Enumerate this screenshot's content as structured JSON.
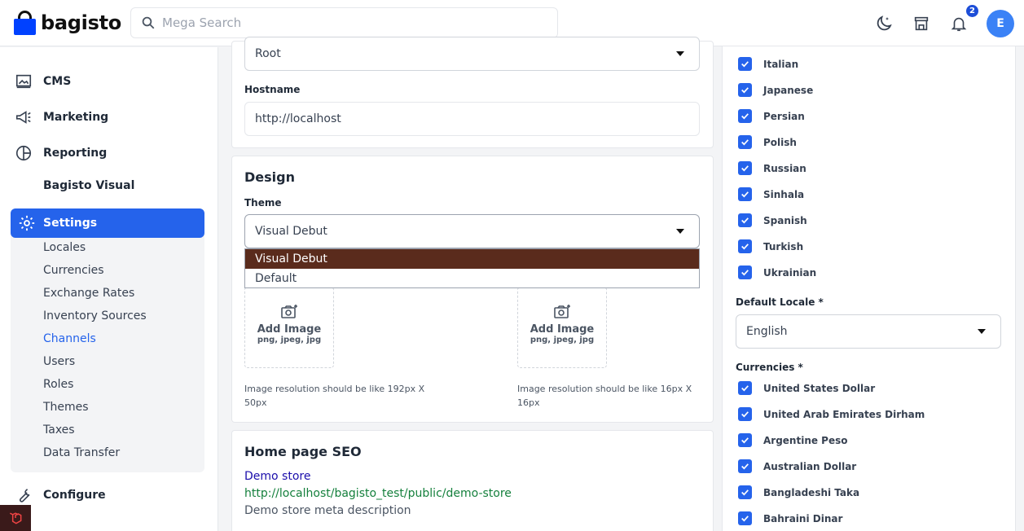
{
  "header": {
    "logo_text": "bagisto",
    "search_placeholder": "Mega Search",
    "notification_count": "2",
    "avatar_initial": "E"
  },
  "sidebar": {
    "items": [
      {
        "label": "CMS",
        "icon": "monitor-icon"
      },
      {
        "label": "Marketing",
        "icon": "megaphone-icon"
      },
      {
        "label": "Reporting",
        "icon": "pie-chart-icon"
      },
      {
        "label": "Bagisto Visual",
        "icon": ""
      }
    ],
    "settings": {
      "label": "Settings",
      "icon": "gear-icon",
      "children": [
        "Locales",
        "Currencies",
        "Exchange Rates",
        "Inventory Sources",
        "Channels",
        "Users",
        "Roles",
        "Themes",
        "Taxes",
        "Data Transfer"
      ],
      "active": "Channels"
    },
    "configure_label": "Configure"
  },
  "general": {
    "root_category_value": "Root",
    "hostname_label": "Hostname",
    "hostname_value": "http://localhost"
  },
  "design": {
    "title": "Design",
    "theme_label": "Theme",
    "theme_value": "Visual Debut",
    "theme_options": [
      "Visual Debut",
      "Default"
    ],
    "logo_upload": {
      "title": "Add Image",
      "formats": "png, jpeg, jpg",
      "hint": "Image resolution should be like 192px X 50px"
    },
    "favicon_upload": {
      "title": "Add Image",
      "formats": "png, jpeg, jpg",
      "hint": "Image resolution should be like 16px X 16px"
    }
  },
  "seo": {
    "title": "Home page SEO",
    "preview_title": "Demo store",
    "preview_url": "http://localhost/bagisto_test/public/demo-store",
    "preview_description": "Demo store meta description"
  },
  "locales": {
    "items": [
      "Italian",
      "Japanese",
      "Persian",
      "Polish",
      "Russian",
      "Sinhala",
      "Spanish",
      "Turkish",
      "Ukrainian"
    ],
    "default_label": "Default Locale *",
    "default_value": "English"
  },
  "currencies": {
    "label": "Currencies *",
    "items": [
      "United States Dollar",
      "United Arab Emirates Dirham",
      "Argentine Peso",
      "Australian Dollar",
      "Bangladeshi Taka",
      "Bahraini Dinar"
    ]
  },
  "colors": {
    "accent": "#2563eb",
    "dropdown_selected": "#5a2b1c"
  }
}
